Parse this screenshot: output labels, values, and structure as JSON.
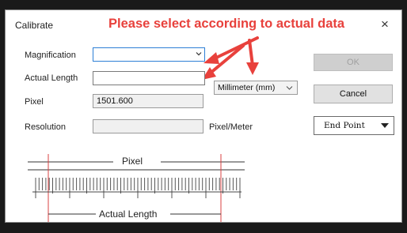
{
  "dialog": {
    "title": "Calibrate",
    "close_glyph": "×",
    "notice": "Please select according to actual data"
  },
  "form": {
    "magnification_label": "Magnification",
    "magnification_value": "",
    "actual_length_label": "Actual Length",
    "actual_length_value": "",
    "unit_selected": "Millimeter (mm)",
    "pixel_label": "Pixel",
    "pixel_value": "1501.600",
    "resolution_label": "Resolution",
    "resolution_value": "",
    "resolution_unit": "Pixel/Meter"
  },
  "buttons": {
    "ok": "OK",
    "cancel": "Cancel",
    "end_point": "End Point"
  },
  "diagram": {
    "pixel_label": "Pixel",
    "actual_length_label": "Actual Length"
  },
  "colors": {
    "annotation_red": "#e8413c",
    "focus_blue": "#2d7fd6"
  },
  "icons": [
    "close-icon",
    "chevron-down-icon",
    "dropdown-triangle-icon",
    "arrow-annotation"
  ]
}
